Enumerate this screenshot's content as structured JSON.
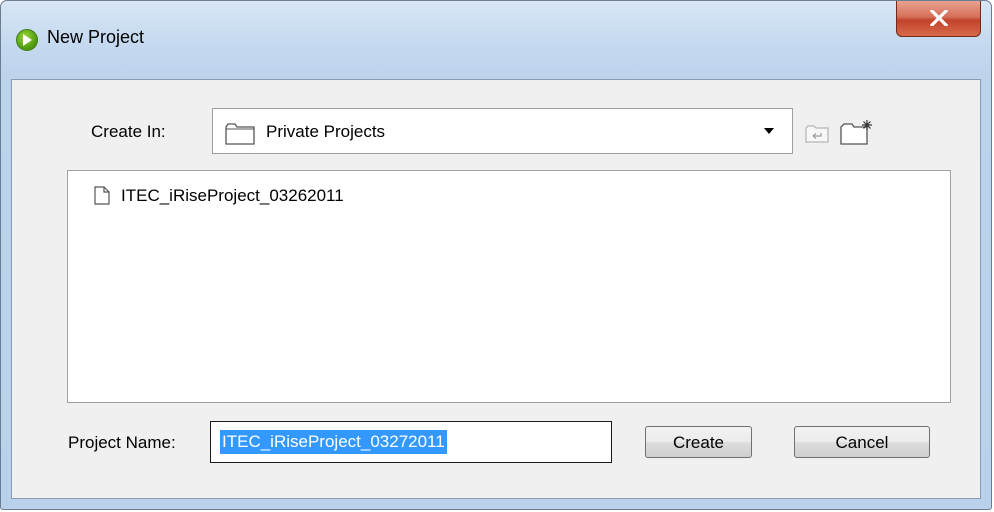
{
  "window": {
    "title": "New Project",
    "close_glyph": "X"
  },
  "create_in": {
    "label": "Create In:",
    "selected": "Private Projects",
    "icons": [
      "folder-icon",
      "up-one-level-icon",
      "create-new-folder-icon"
    ]
  },
  "projects": [
    {
      "name": "ITEC_iRiseProject_03262011",
      "icon": "file-icon"
    }
  ],
  "project_name": {
    "label": "Project Name:",
    "value": "ITEC_iRiseProject_03272011"
  },
  "buttons": {
    "create": "Create",
    "cancel": "Cancel"
  },
  "colors": {
    "selection": "#3399ff",
    "close_button": "#c74a30",
    "app_icon": "#5aa516"
  }
}
